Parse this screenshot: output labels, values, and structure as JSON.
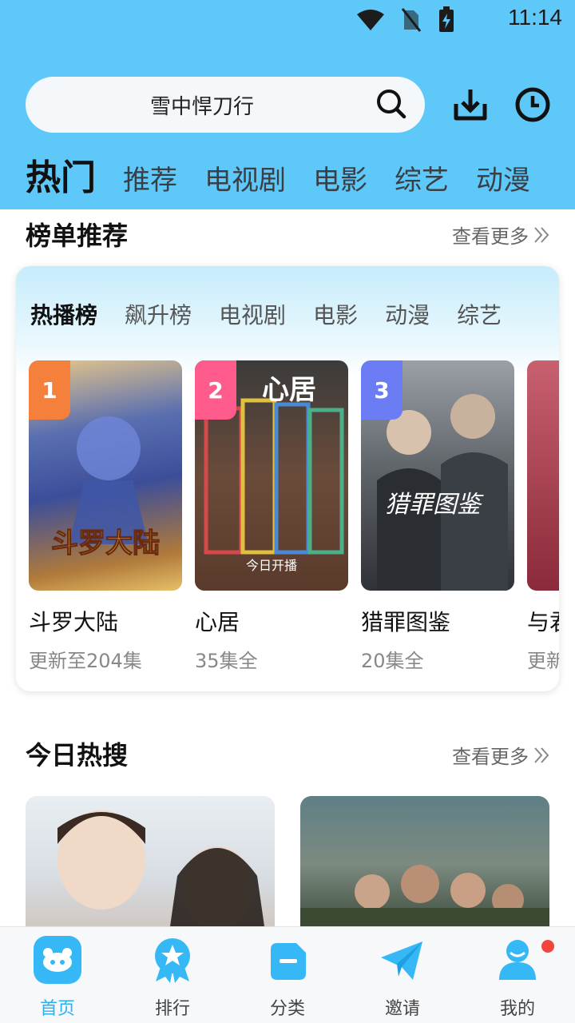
{
  "status": {
    "time": "11:14",
    "icons": [
      "wifi-icon",
      "no-sim-icon",
      "battery-charging-icon"
    ]
  },
  "search": {
    "text": "雪中悍刀行"
  },
  "header_actions": [
    "download-icon",
    "history-clock-icon"
  ],
  "nav_tabs": [
    "热门",
    "推荐",
    "电视剧",
    "电影",
    "综艺",
    "动漫"
  ],
  "rank_section": {
    "title": "榜单推荐",
    "more": "查看更多",
    "tabs": [
      "热播榜",
      "飙升榜",
      "电视剧",
      "电影",
      "动漫",
      "综艺"
    ],
    "shows": [
      {
        "rank": "1",
        "title": "斗罗大陆",
        "sub": "更新至204集",
        "badge_color": "#f4803c"
      },
      {
        "rank": "2",
        "title": "心居",
        "sub": "35集全",
        "badge_color": "#ff5b8c"
      },
      {
        "rank": "3",
        "title": "猎罪图鉴",
        "sub": "20集全",
        "badge_color": "#6c7cf5"
      },
      {
        "rank": "",
        "title": "与君",
        "sub": "更新",
        "badge_color": ""
      }
    ],
    "poster_texts": {
      "p1": "斗罗大陆",
      "p2_title": "心居",
      "p2_sub": "今日开播",
      "p3": "猎罪图鉴"
    }
  },
  "hot_section": {
    "title": "今日热搜",
    "more": "查看更多"
  },
  "bottom_nav": [
    {
      "label": "首页",
      "icon": "home-icon",
      "active": true
    },
    {
      "label": "排行",
      "icon": "ranking-medal-icon",
      "active": false
    },
    {
      "label": "分类",
      "icon": "category-icon",
      "active": false
    },
    {
      "label": "邀请",
      "icon": "paper-plane-icon",
      "active": false
    },
    {
      "label": "我的",
      "icon": "user-icon",
      "active": false
    }
  ],
  "colors": {
    "header": "#5ec8f9",
    "accent": "#2ab1f0",
    "notification": "#f2453d"
  }
}
